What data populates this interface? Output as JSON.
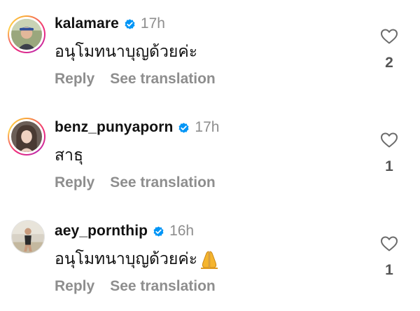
{
  "comments": [
    {
      "username": "kalamare",
      "time": "17h",
      "text": "อนุโมทนาบุญด้วยค่ะ",
      "likes": "2",
      "reply_label": "Reply",
      "translate_label": "See translation",
      "verified": true,
      "story_ring": true,
      "emoji": ""
    },
    {
      "username": "benz_punyaporn",
      "time": "17h",
      "text": "สาธุ",
      "likes": "1",
      "reply_label": "Reply",
      "translate_label": "See translation",
      "verified": true,
      "story_ring": true,
      "emoji": ""
    },
    {
      "username": "aey_pornthip",
      "time": "16h",
      "text": "อนุโมทนาบุญด้วยค่ะ",
      "likes": "1",
      "reply_label": "Reply",
      "translate_label": "See translation",
      "verified": true,
      "story_ring": false,
      "emoji": "folded-hands-emoji"
    }
  ],
  "colors": {
    "verified_blue": "#0095f6",
    "secondary_text": "#8e8e8e",
    "primary_text": "#111111",
    "story_ring": [
      "#f9a53a",
      "#ee2a7b",
      "#c02ba8"
    ]
  },
  "icons": {
    "like": "heart-outline-icon",
    "verified": "verified-badge-icon"
  }
}
